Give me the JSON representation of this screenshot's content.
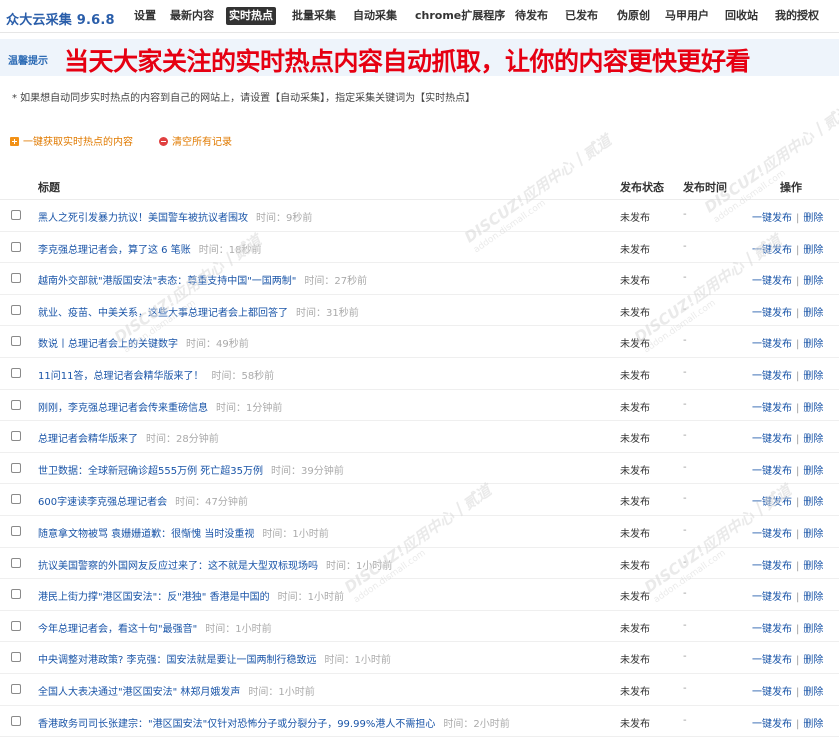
{
  "app": {
    "title": "众大云采集 9.6.8"
  },
  "nav": [
    {
      "label": "设置",
      "active": false
    },
    {
      "label": "最新内容",
      "active": false
    },
    {
      "label": "实时热点",
      "active": true
    },
    {
      "label": "批量采集",
      "active": false
    },
    {
      "label": "自动采集",
      "active": false
    },
    {
      "label": "chrome扩展程序",
      "active": false
    },
    {
      "label": "待发布",
      "active": false
    },
    {
      "label": "已发布",
      "active": false
    },
    {
      "label": "伪原创",
      "active": false
    },
    {
      "label": "马甲用户",
      "active": false
    },
    {
      "label": "回收站",
      "active": false
    },
    {
      "label": "我的授权",
      "active": false
    }
  ],
  "tip": {
    "label": "温馨提示",
    "headline": "当天大家关注的实时热点内容自动抓取，让你的内容更快更好看"
  },
  "notice": "* 如果想自动同步实时热点的内容到自己的网站上，请设置【自动采集】，指定采集关键词为【实时热点】",
  "actions": {
    "fetch": "一键获取实时热点的内容",
    "clear": "清空所有记录"
  },
  "table": {
    "headers": {
      "title": "标题",
      "status": "发布状态",
      "time": "发布时间",
      "ops": "操作"
    },
    "rows": [
      {
        "title": "黑人之死引发暴力抗议！美国警车被抗议者围攻",
        "time": "时间：9秒前",
        "status": "未发布",
        "pubtime": "-"
      },
      {
        "title": "李克强总理记者会，算了这 6 笔账",
        "time": "时间：18秒前",
        "status": "未发布",
        "pubtime": "-"
      },
      {
        "title": "越南外交部就\"港版国安法\"表态：尊重支持中国\"一国两制\"",
        "time": "时间：27秒前",
        "status": "未发布",
        "pubtime": "-"
      },
      {
        "title": "就业、疫苗、中美关系，这些大事总理记者会上都回答了",
        "time": "时间：31秒前",
        "status": "未发布",
        "pubtime": "-"
      },
      {
        "title": "数说丨总理记者会上的关键数字",
        "time": "时间：49秒前",
        "status": "未发布",
        "pubtime": "-"
      },
      {
        "title": "11问11答，总理记者会精华版来了！",
        "time": "时间：58秒前",
        "status": "未发布",
        "pubtime": "-"
      },
      {
        "title": "刚刚，李克强总理记者会传来重磅信息",
        "time": "时间：1分钟前",
        "status": "未发布",
        "pubtime": "-"
      },
      {
        "title": "总理记者会精华版来了",
        "time": "时间：28分钟前",
        "status": "未发布",
        "pubtime": "-"
      },
      {
        "title": "世卫数据：全球新冠确诊超555万例 死亡超35万例",
        "time": "时间：39分钟前",
        "status": "未发布",
        "pubtime": "-"
      },
      {
        "title": "600字速读李克强总理记者会",
        "time": "时间：47分钟前",
        "status": "未发布",
        "pubtime": "-"
      },
      {
        "title": "随意拿文物被骂 袁姗姗道歉：很惭愧 当时没重视",
        "time": "时间：1小时前",
        "status": "未发布",
        "pubtime": "-"
      },
      {
        "title": "抗议美国警察的外国网友反应过来了：这不就是大型双标现场吗",
        "time": "时间：1小时前",
        "status": "未发布",
        "pubtime": "-"
      },
      {
        "title": "港民上街力撑\"港区国安法\"：反\"港独\" 香港是中国的",
        "time": "时间：1小时前",
        "status": "未发布",
        "pubtime": "-"
      },
      {
        "title": "今年总理记者会，看这十句\"最强音\"",
        "time": "时间：1小时前",
        "status": "未发布",
        "pubtime": "-"
      },
      {
        "title": "中央调整对港政策? 李克强：国安法就是要让一国两制行稳致远",
        "time": "时间：1小时前",
        "status": "未发布",
        "pubtime": "-"
      },
      {
        "title": "全国人大表决通过\"港区国安法\" 林郑月娥发声",
        "time": "时间：1小时前",
        "status": "未发布",
        "pubtime": "-"
      },
      {
        "title": "香港政务司司长张建宗：\"港区国安法\"仅针对恐怖分子或分裂分子，99.99%港人不需担心",
        "time": "时间：2小时前",
        "status": "未发布",
        "pubtime": "-"
      }
    ],
    "op_publish": "一键发布",
    "op_sep": "|",
    "op_delete": "删除"
  },
  "watermark": {
    "main": "DISCUZ!应用中心丨贰道",
    "sub": "addon.dismall.com"
  }
}
